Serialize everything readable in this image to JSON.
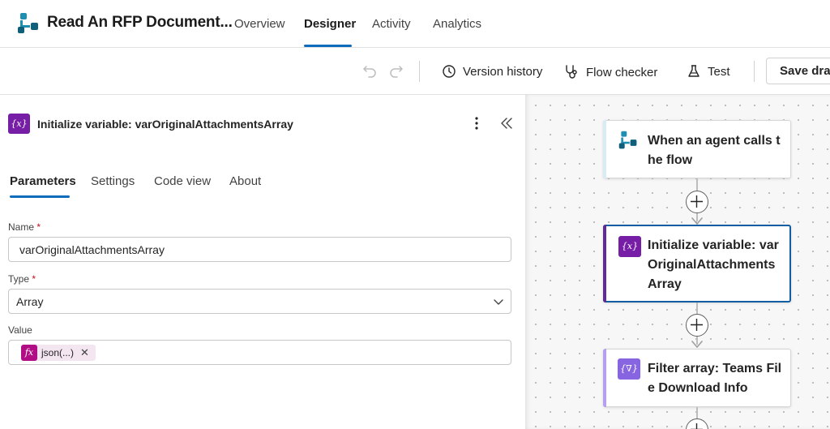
{
  "app": {
    "title": "Read An RFP Document...",
    "icon": "flow-agent-icon"
  },
  "header": {
    "tabs": [
      {
        "label": "Overview"
      },
      {
        "label": "Designer",
        "active": true
      },
      {
        "label": "Activity"
      },
      {
        "label": "Analytics"
      }
    ]
  },
  "toolbar": {
    "undo_icon": "undo-icon",
    "redo_icon": "redo-icon",
    "version_history": "Version history",
    "flow_checker": "Flow checker",
    "test": "Test",
    "save": "Save draft"
  },
  "panel": {
    "title": "Initialize variable: varOriginalAttachmentsArray",
    "icon_text": "{x}",
    "tabs": [
      {
        "label": "Parameters",
        "active": true
      },
      {
        "label": "Settings"
      },
      {
        "label": "Code view"
      },
      {
        "label": "About"
      }
    ],
    "fields": {
      "name": {
        "label": "Name",
        "required_mark": "*",
        "value": "varOriginalAttachmentsArray"
      },
      "type": {
        "label": "Type",
        "required_mark": "*",
        "value": "Array"
      },
      "value": {
        "label": "Value",
        "token_icon": "fx",
        "token_label": "json(...)",
        "token_close": "✕"
      }
    }
  },
  "canvas": {
    "nodes": [
      {
        "title": "When an agent calls the flow",
        "icon": "agent-trigger-icon"
      },
      {
        "title": "Initialize variable: varOriginalAttachmentsArray",
        "icon_text": "{x}",
        "selected": true
      },
      {
        "title": "Filter array: Teams File Download Info",
        "icon_text": "{∇}"
      }
    ]
  },
  "colors": {
    "accent": "#0f6cbd",
    "variable_purple": "#771ea6",
    "filter_purple": "#8764e0",
    "expression_magenta": "#b10e86",
    "trigger_teal": "#0f7b8f"
  }
}
